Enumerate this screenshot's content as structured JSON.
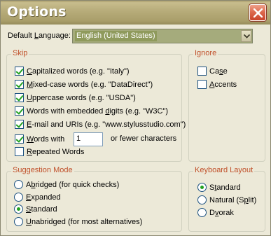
{
  "window": {
    "title": "Options"
  },
  "language": {
    "label_pre": "Default ",
    "label_ul": "L",
    "label_post": "anguage:",
    "value": "English (United States)"
  },
  "skip": {
    "title": "Skip",
    "items": [
      {
        "pre": "",
        "ul": "C",
        "post": "apitalized words (e.g. \"Italy\")",
        "checked": true
      },
      {
        "pre": "",
        "ul": "M",
        "post": "ixed-case words (e.g. \"DataDirect\")",
        "checked": true
      },
      {
        "pre": "",
        "ul": "U",
        "post": "ppercase words (e.g. \"USDA\")",
        "checked": true
      },
      {
        "pre": "Words with embedded ",
        "ul": "d",
        "post": "igits (e.g. \"W3C\")",
        "checked": true
      },
      {
        "pre": "",
        "ul": "E",
        "post": "-mail and URIs (e.g. \"www.stylusstudio.com\")",
        "checked": true
      },
      {
        "pre": "",
        "ul": "W",
        "post": "ords with",
        "checked": true
      },
      {
        "pre": "",
        "ul": "R",
        "post": "epeated Words",
        "checked": false
      }
    ],
    "words_with_value": "1",
    "words_with_suffix": "or fewer characters"
  },
  "ignore": {
    "title": "Ignore",
    "items": [
      {
        "pre": "Ca",
        "ul": "s",
        "post": "e",
        "checked": false
      },
      {
        "pre": "",
        "ul": "A",
        "post": "ccents",
        "checked": false
      }
    ]
  },
  "suggestion": {
    "title": "Suggestion Mode",
    "items": [
      {
        "pre": "A",
        "ul": "b",
        "post": "ridged (for quick checks)",
        "checked": false
      },
      {
        "pre": "",
        "ul": "E",
        "post": "xpanded",
        "checked": false
      },
      {
        "pre": "",
        "ul": "S",
        "post": "tandard",
        "checked": true
      },
      {
        "pre": "",
        "ul": "U",
        "post": "nabridged (for most alternatives)",
        "checked": false
      }
    ]
  },
  "keyboard": {
    "title": "Keyboard Layout",
    "items": [
      {
        "pre": "S",
        "ul": "t",
        "post": "andard",
        "checked": true
      },
      {
        "pre": "Natural (S",
        "ul": "p",
        "post": "lit)",
        "checked": false
      },
      {
        "pre": "D",
        "ul": "v",
        "post": "orak",
        "checked": false
      }
    ]
  }
}
